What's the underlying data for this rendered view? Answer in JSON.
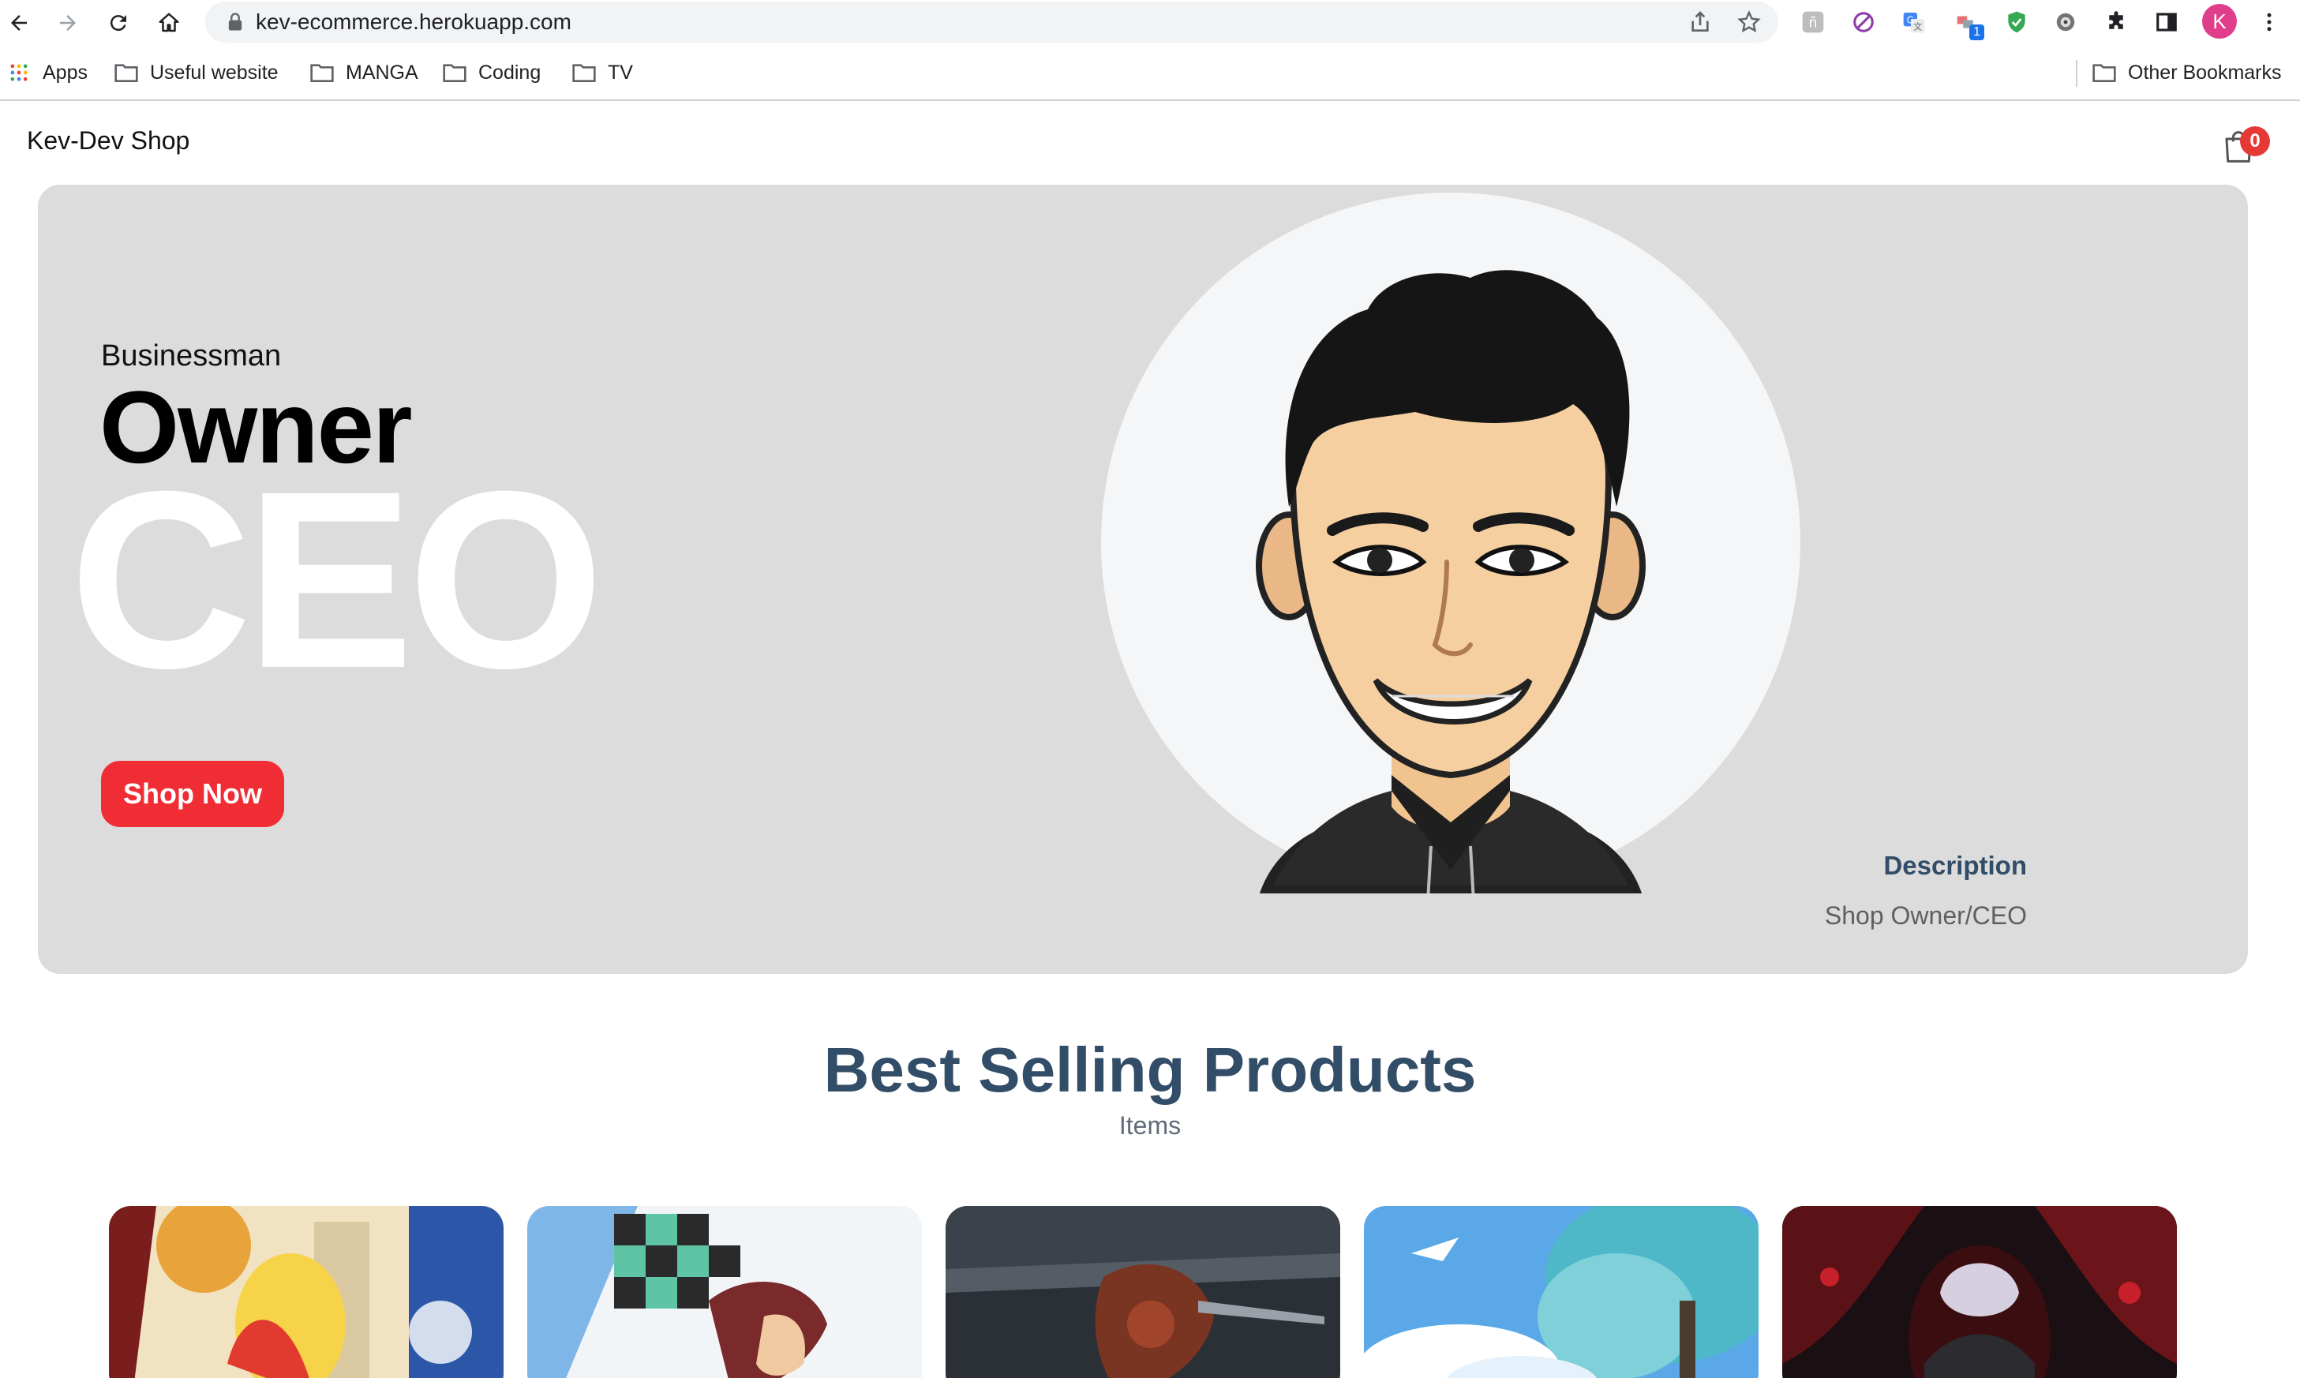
{
  "browser": {
    "url": "kev-ecommerce.herokuapp.com",
    "profile_initial": "K",
    "extension_badge": "1",
    "bookmarks": [
      {
        "label": "Apps"
      },
      {
        "label": "Useful website"
      },
      {
        "label": "MANGA"
      },
      {
        "label": "Coding"
      },
      {
        "label": "TV"
      }
    ],
    "other_bookmarks": "Other Bookmarks"
  },
  "navbar": {
    "site_name": "Kev-Dev Shop",
    "cart_count": "0"
  },
  "hero": {
    "small_text": "Businessman",
    "mid_text": "Owner",
    "large_text": "CEO",
    "button_label": "Shop Now",
    "description_title": "Description",
    "description_text": "Shop Owner/CEO"
  },
  "products_section": {
    "title": "Best Selling Products",
    "subtitle": "Items"
  },
  "colors": {
    "brand_red": "#f02d34",
    "heading_blue": "#324d67",
    "hero_bg": "#dcdcdc"
  }
}
